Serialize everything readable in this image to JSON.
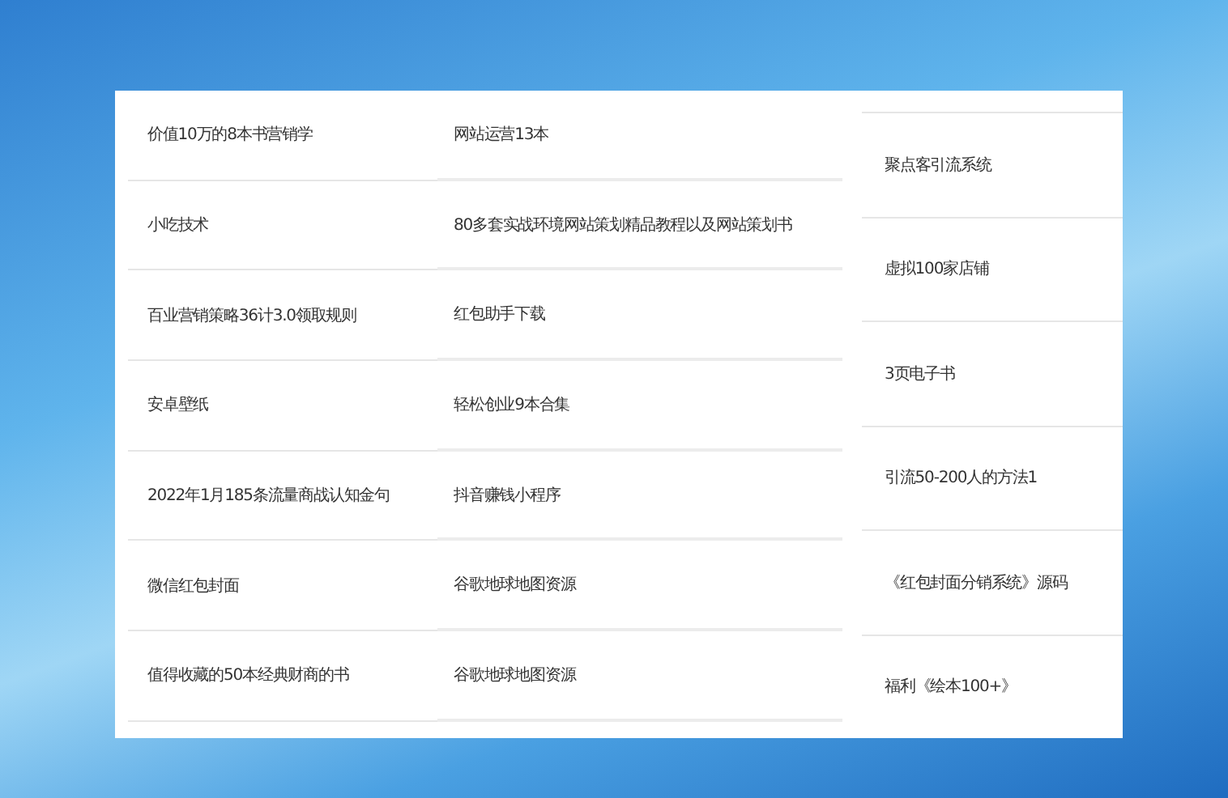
{
  "columns": [
    {
      "items": [
        "价值10万的8本书营销学",
        "小吃技术",
        "百业营销策略36计3.0领取规则",
        "安卓壁纸",
        "2022年1月185条流量商战认知金句",
        "微信红包封面",
        "值得收藏的50本经典财商的书"
      ]
    },
    {
      "items": [
        "网站运营13本",
        "80多套实战环境网站策划精品教程以及网站策划书",
        "红包助手下载",
        "轻松创业9本合集",
        "抖音赚钱小程序",
        "谷歌地球地图资源",
        "谷歌地球地图资源"
      ]
    },
    {
      "items": [
        "聚点客引流系统",
        "虚拟100家店铺",
        "3页电子书",
        "引流50-200人的方法1",
        "《红包封面分销系统》源码",
        "福利《绘本100+》"
      ]
    }
  ]
}
